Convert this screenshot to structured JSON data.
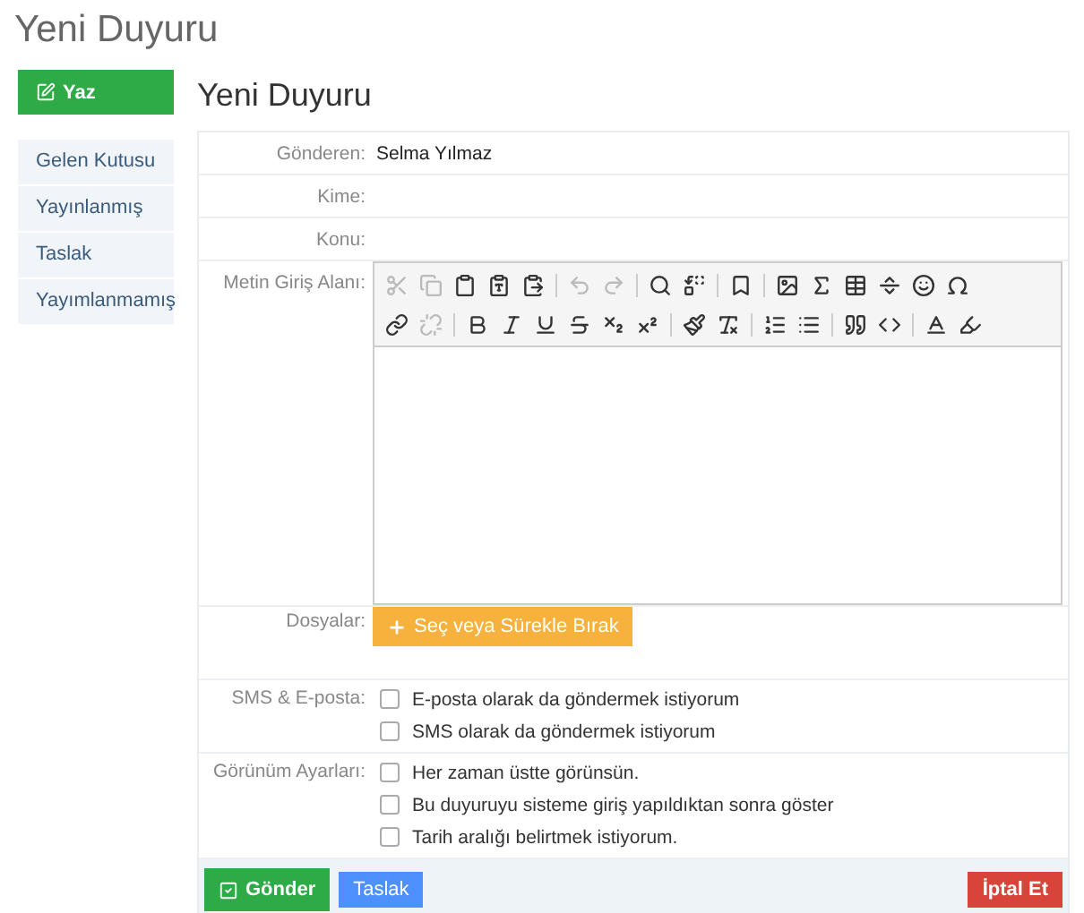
{
  "page_title": "Yeni Duyuru",
  "sidebar": {
    "compose_button": "Yaz",
    "items": [
      {
        "label": "Gelen Kutusu",
        "selected": false
      },
      {
        "label": "Yayınlanmış",
        "selected": false
      },
      {
        "label": "Taslak",
        "selected": false
      },
      {
        "label": "Yayımlanmamış",
        "selected": false
      }
    ]
  },
  "form": {
    "heading": "Yeni Duyuru",
    "fields": [
      {
        "label": "Gönderen:",
        "value": "Selma Yılmaz"
      },
      {
        "label": "Kime:"
      },
      {
        "label": "Konu:"
      }
    ],
    "editor": {
      "label": "Metin Giriş Alanı:"
    },
    "files": {
      "label": "Dosyalar:",
      "button": "Seç veya Sürekle Bırak"
    },
    "option_groups": [
      {
        "label": "SMS & E-posta:",
        "options": [
          {
            "label": "E-posta olarak da göndermek istiyorum",
            "checked": false
          },
          {
            "label": "SMS olarak da göndermek istiyorum",
            "checked": false
          }
        ]
      },
      {
        "label": "Görünüm Ayarları:",
        "options": [
          {
            "label": "Her zaman üstte görünsün.",
            "checked": false
          },
          {
            "label": "Bu duyuruyu sisteme giriş yapıldıktan sonra göster",
            "checked": false
          },
          {
            "label": "Tarih aralığı belirtmek istiyorum.",
            "checked": false
          }
        ]
      }
    ],
    "buttons": [
      {
        "kind": "send",
        "label": "Gönder"
      },
      {
        "kind": "draft",
        "label": "Taslak"
      },
      {
        "kind": "cancel",
        "label": "İptal Et"
      }
    ]
  }
}
